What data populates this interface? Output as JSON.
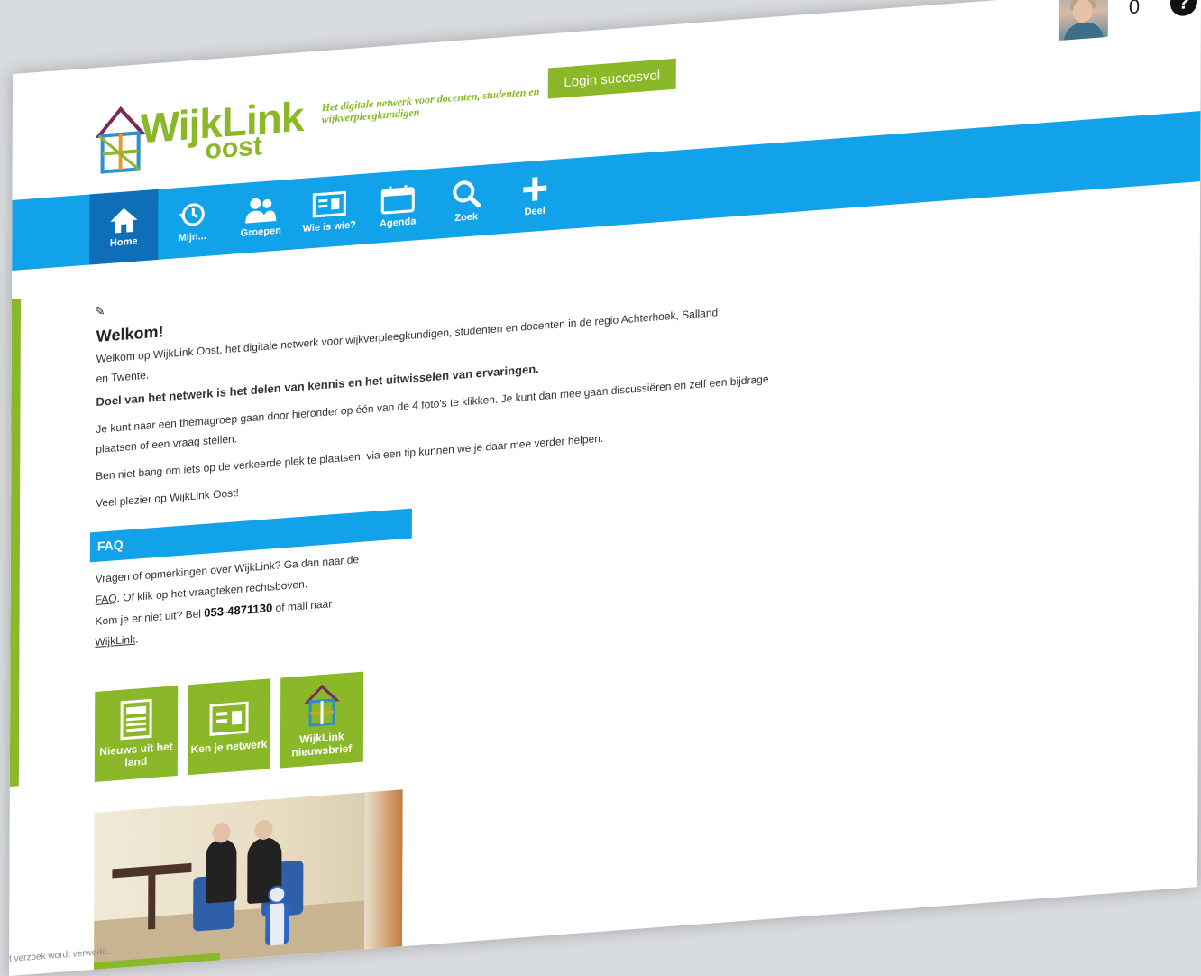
{
  "header": {
    "logo_main": "WijkLink",
    "logo_sub": "oost",
    "tagline": "Het digitale netwerk voor docenten, studenten en wijkverpleegkundigen",
    "login_badge": "Login succesvol",
    "notification_count": "0",
    "help_glyph": "?"
  },
  "nav": {
    "items": [
      {
        "label": "Home",
        "icon": "home-icon",
        "active": true
      },
      {
        "label": "Mijn...",
        "icon": "history-icon"
      },
      {
        "label": "Groepen",
        "icon": "groups-icon"
      },
      {
        "label": "Wie is wie?",
        "icon": "contact-card-icon"
      },
      {
        "label": "Agenda",
        "icon": "calendar-icon"
      },
      {
        "label": "Zoek",
        "icon": "search-icon"
      },
      {
        "label": "Deel",
        "icon": "plus-icon"
      }
    ]
  },
  "welcome": {
    "title": "Welkom!",
    "intro": "Welkom op WijkLink Oost, het digitale netwerk voor wijkverpleegkundigen, studenten en docenten in de regio Achterhoek, Salland en Twente.",
    "goal": "Doel van het netwerk is het delen van kennis en het uitwisselen van ervaringen.",
    "instructions": "Je kunt naar een themagroep gaan door hieronder op één van de 4 foto's te klikken. Je kunt dan mee gaan discussiëren en zelf een bijdrage plaatsen of een vraag stellen.",
    "reassurance": "Ben niet bang om iets op de verkeerde plek te plaatsen, via een tip kunnen we je daar mee verder helpen.",
    "closing": "Veel plezier op WijkLink Oost!"
  },
  "faq": {
    "title": "FAQ",
    "line1": "Vragen of opmerkingen over WijkLink? Ga dan naar de",
    "faq_link": "FAQ",
    "line2": ". Of klik op het vraagteken rechtsboven.",
    "line3": "Kom je er niet uit? Bel ",
    "phone": "053-4871130",
    "line4": " of mail naar",
    "mail_link": "WijkLink",
    "period": "."
  },
  "tiles": [
    {
      "label": "Nieuws uit het land",
      "icon": "newspaper-icon"
    },
    {
      "label": "Ken je netwerk",
      "icon": "contact-card-icon"
    },
    {
      "label": "WijkLink nieuwsbrief",
      "icon": "logo-house-icon"
    }
  ],
  "status_bar": "t verzoek wordt verwerkt...",
  "colors": {
    "brand_green": "#8ab828",
    "nav_blue": "#12a2ea",
    "nav_active": "#0e6fb8"
  }
}
